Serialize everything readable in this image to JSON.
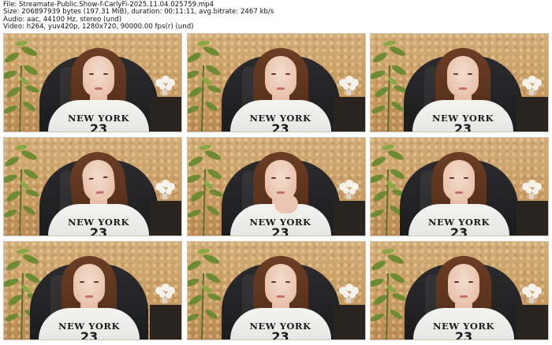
{
  "header": {
    "file_line": "File: Streamate-Public.Show-f-CarlyFi-2025.11.04.025759.mp4",
    "size_line": "Size: 206897939 bytes (197.31 MiB), duration: 00:11:11, avg.bitrate: 2467 kb/s",
    "audio_line": "Audio: aac, 44100 Hz, stereo (und)",
    "video_line": "Video: h264, yuv420p, 1280x720, 90000.00 fps(r) (und)"
  },
  "shirt_print": {
    "word": "NEW YORK",
    "number": "23"
  },
  "thumbnails": [
    {
      "index": 1
    },
    {
      "index": 2
    },
    {
      "index": 3
    },
    {
      "index": 4
    },
    {
      "index": 5
    },
    {
      "index": 6
    },
    {
      "index": 7
    },
    {
      "index": 8
    },
    {
      "index": 9
    }
  ]
}
